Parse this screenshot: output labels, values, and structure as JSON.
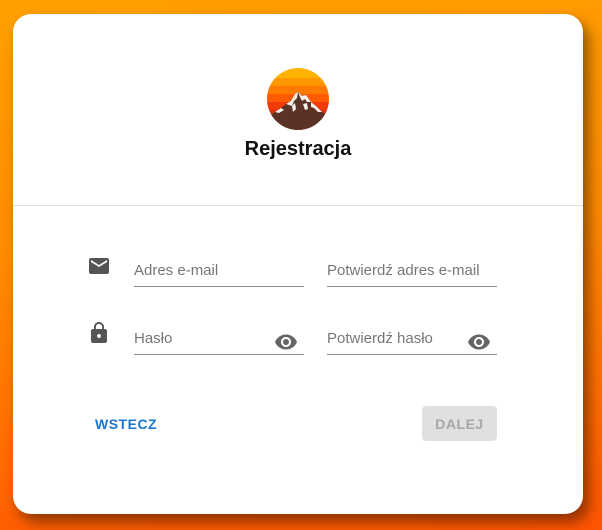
{
  "header": {
    "title": "Rejestracja",
    "logo_icon": "mountain-sunset-logo-icon"
  },
  "form": {
    "email_icon": "mail-icon",
    "lock_icon": "lock-icon",
    "email_placeholder": "Adres e-mail",
    "email_value": "",
    "confirm_email_placeholder": "Potwierdź adres e-mail",
    "confirm_email_value": "",
    "password_placeholder": "Hasło",
    "password_value": "",
    "confirm_password_placeholder": "Potwierdź hasło",
    "confirm_password_value": "",
    "visibility_icon": "eye-icon"
  },
  "actions": {
    "back_label": "WSTECZ",
    "next_label": "DALEJ",
    "next_disabled": true
  },
  "colors": {
    "accent": "#1976d2",
    "background_top": "#ffa000",
    "background_bottom": "#ff5400",
    "disabled_bg": "#e0e0e0",
    "disabled_text": "#a6a6a6"
  }
}
